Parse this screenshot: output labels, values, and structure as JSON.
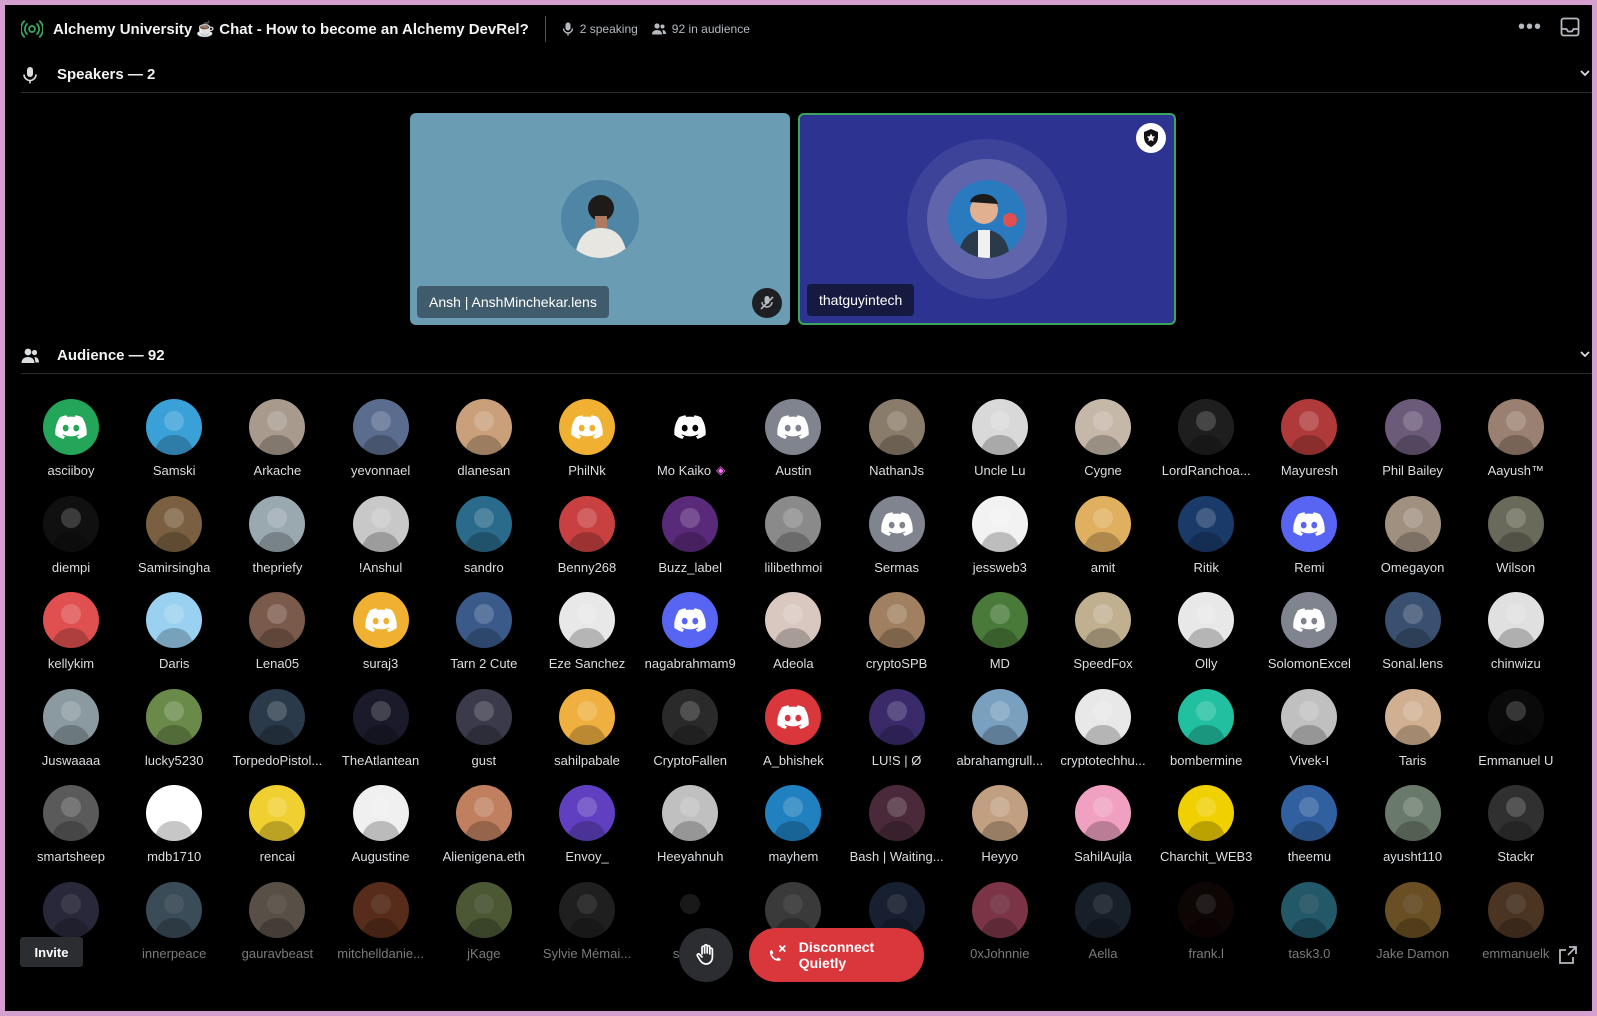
{
  "header": {
    "stage_name": "Alchemy University ☕ Chat - How to become an Alchemy DevRel?",
    "speaking": "2 speaking",
    "audience_count": "92 in audience"
  },
  "speakers_section": {
    "title": "Speakers — 2"
  },
  "speakers": [
    {
      "name": "Ansh | AnshMinchekar.lens",
      "muted": true
    },
    {
      "name": "thatguyintech",
      "moderator": true,
      "speaking": true
    }
  ],
  "audience_section": {
    "title": "Audience — 92"
  },
  "audience": [
    {
      "name": "asciiboy",
      "color": "#23a55a",
      "icon": "discord-logo"
    },
    {
      "name": "Samski",
      "color": "#3aa0d8"
    },
    {
      "name": "Arkache",
      "color": "#a89a8d"
    },
    {
      "name": "yevonnael",
      "color": "#5b6d8f"
    },
    {
      "name": "dlanesan",
      "color": "#c9a07a"
    },
    {
      "name": "PhilNk",
      "color": "#f0b132",
      "icon": "discord-logo"
    },
    {
      "name": "Mo Kaiko",
      "color": "#000000",
      "icon": "discord-logo",
      "badge": "◈"
    },
    {
      "name": "Austin",
      "color": "#80848e",
      "icon": "discord-logo"
    },
    {
      "name": "NathanJs",
      "color": "#8a7c6a"
    },
    {
      "name": "Uncle Lu",
      "color": "#d9d9d9"
    },
    {
      "name": "Cygne",
      "color": "#c5b8a8"
    },
    {
      "name": "LordRanchoa...",
      "color": "#1e1e1e"
    },
    {
      "name": "Mayuresh",
      "color": "#b03a3a"
    },
    {
      "name": "Phil Bailey",
      "color": "#6b5a7a"
    },
    {
      "name": "Aayush™",
      "color": "#9a8070"
    },
    {
      "name": "diempi",
      "color": "#101010"
    },
    {
      "name": "Samirsingha",
      "color": "#7a6040"
    },
    {
      "name": "thepriefy",
      "color": "#9aa8b0"
    },
    {
      "name": "!Anshul",
      "color": "#c8c8c8"
    },
    {
      "name": "sandro",
      "color": "#2a6a8a"
    },
    {
      "name": "Benny268",
      "color": "#c84040"
    },
    {
      "name": "Buzz_label",
      "color": "#5a2a7a"
    },
    {
      "name": "lilibethmoi",
      "color": "#8a8a8a"
    },
    {
      "name": "Sermas",
      "color": "#80848e",
      "icon": "discord-logo"
    },
    {
      "name": "jessweb3",
      "color": "#f2f2f2"
    },
    {
      "name": "amit",
      "color": "#e0b060"
    },
    {
      "name": "Ritik",
      "color": "#1a3a6a"
    },
    {
      "name": "Remi",
      "color": "#5865f2",
      "icon": "discord-logo"
    },
    {
      "name": "Omegayon",
      "color": "#a09080"
    },
    {
      "name": "Wilson",
      "color": "#6a6a5a"
    },
    {
      "name": "kellykim",
      "color": "#e05050"
    },
    {
      "name": "Daris",
      "color": "#9ad0f0"
    },
    {
      "name": "Lena05",
      "color": "#7a5a4a"
    },
    {
      "name": "suraj3",
      "color": "#f0b132",
      "icon": "discord-logo"
    },
    {
      "name": "Tarn 2 Cute",
      "color": "#3a5a8a"
    },
    {
      "name": "Eze Sanchez",
      "color": "#e8e8e8"
    },
    {
      "name": "nagabrahmam9",
      "color": "#5865f2",
      "icon": "discord-logo"
    },
    {
      "name": "Adeola",
      "color": "#d8c8c0"
    },
    {
      "name": "cryptoSPB",
      "color": "#a08060"
    },
    {
      "name": "MD",
      "color": "#4a7a3a"
    },
    {
      "name": "SpeedFox",
      "color": "#c0b090"
    },
    {
      "name": "Olly",
      "color": "#e8e8e8"
    },
    {
      "name": "SolomonExcel",
      "color": "#80848e",
      "icon": "discord-logo"
    },
    {
      "name": "Sonal.lens",
      "color": "#3a5070"
    },
    {
      "name": "chinwizu",
      "color": "#e0e0e0"
    },
    {
      "name": "Juswaaaa",
      "color": "#8a9aa0"
    },
    {
      "name": "lucky5230",
      "color": "#6a8a4a"
    },
    {
      "name": "TorpedoPistol...",
      "color": "#2a3a4a"
    },
    {
      "name": "TheAtlantean",
      "color": "#1a1a2a"
    },
    {
      "name": "gust",
      "color": "#3a3a4a"
    },
    {
      "name": "sahilpabale",
      "color": "#f0b040"
    },
    {
      "name": "CryptoFallen",
      "color": "#2a2a2a"
    },
    {
      "name": "A_bhishek",
      "color": "#da373c",
      "icon": "discord-logo"
    },
    {
      "name": "LU!S | Ø",
      "color": "#3a2a6a"
    },
    {
      "name": "abrahamgrull...",
      "color": "#7aa0c0"
    },
    {
      "name": "cryptotechhu...",
      "color": "#e8e8e8"
    },
    {
      "name": "bombermine",
      "color": "#20c0a0"
    },
    {
      "name": "Vivek-I",
      "color": "#c0c0c0"
    },
    {
      "name": "Taris",
      "color": "#d0b090"
    },
    {
      "name": "Emmanuel U",
      "color": "#0a0a0a"
    },
    {
      "name": "smartsheep",
      "color": "#5a5a5a"
    },
    {
      "name": "mdb1710",
      "color": "#ffffff"
    },
    {
      "name": "rencai",
      "color": "#f0d030"
    },
    {
      "name": "Augustine",
      "color": "#f0f0f0"
    },
    {
      "name": "Alienigena.eth",
      "color": "#c08060"
    },
    {
      "name": "Envoy_",
      "color": "#6040c0"
    },
    {
      "name": "Heeyahnuh",
      "color": "#c0c0c0"
    },
    {
      "name": "mayhem",
      "color": "#2080c0"
    },
    {
      "name": "Bash | Waiting...",
      "color": "#4a2a3a"
    },
    {
      "name": "Heyyo",
      "color": "#c0a080"
    },
    {
      "name": "SahilAujla",
      "color": "#f0a0c0"
    },
    {
      "name": "Charchit_WEB3",
      "color": "#f0d000"
    },
    {
      "name": "theemu",
      "color": "#3060a0"
    },
    {
      "name": "ayusht110",
      "color": "#6a7a6a"
    },
    {
      "name": "Stackr",
      "color": "#303030"
    },
    {
      "name": "",
      "color": "#4a4a6a"
    },
    {
      "name": "innerpeace",
      "color": "#6a8aa0"
    },
    {
      "name": "gauravbeast",
      "color": "#a09080"
    },
    {
      "name": "mitchelldanie...",
      "color": "#a05030"
    },
    {
      "name": "jKage",
      "color": "#8aa060"
    },
    {
      "name": "Sylvie Mémai...",
      "color": "#3a3a3a"
    },
    {
      "name": "shyan",
      "color": "#000000"
    },
    {
      "name": "",
      "color": "#6a6a6a"
    },
    {
      "name": "",
      "color": "#2a3a5a"
    },
    {
      "name": "0xJohnnie",
      "color": "#e06080"
    },
    {
      "name": "Aella",
      "color": "#2a3a4a"
    },
    {
      "name": "frank.l",
      "color": "#1a0a0a"
    },
    {
      "name": "task3.0",
      "color": "#40a0c0"
    },
    {
      "name": "Jake Damon",
      "color": "#c09040"
    },
    {
      "name": "emmanuelk",
      "color": "#8a6040"
    }
  ],
  "controls": {
    "invite": "Invite",
    "disconnect": "Disconnect Quietly"
  },
  "colors": {
    "background": "#000000",
    "frame": "#d59fd0",
    "speaking_ring": "#3ba55d",
    "disconnect": "#da373c"
  }
}
